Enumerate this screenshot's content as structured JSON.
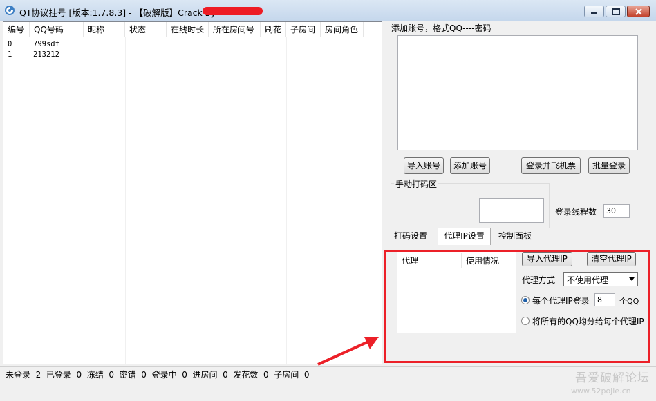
{
  "window": {
    "title": "QT协议挂号 [版本:1.7.8.3] - 【破解版】Crack by"
  },
  "table": {
    "columns": [
      "编号",
      "QQ号码",
      "昵称",
      "状态",
      "在线时长",
      "所在房间号",
      "刷花",
      "子房间",
      "房间角色"
    ],
    "rows": [
      {
        "id": "0",
        "qq": "799sdf"
      },
      {
        "id": "1",
        "qq": "213212"
      }
    ]
  },
  "accounts": {
    "label": "添加账号，格式QQ----密码",
    "import_btn": "导入账号",
    "add_btn": "添加账号",
    "login_ticket_btn": "登录并飞机票",
    "batch_login_btn": "批量登录"
  },
  "captcha": {
    "group_label": "手动打码区",
    "threads_label": "登录线程数",
    "threads_value": "30"
  },
  "tabs": [
    "打码设置",
    "代理IP设置",
    "控制面板"
  ],
  "proxy": {
    "col_proxy": "代理",
    "col_usage": "使用情况",
    "import_btn": "导入代理IP",
    "clear_btn": "清空代理IP",
    "mode_label": "代理方式",
    "mode_value": "不使用代理",
    "opt1_label": "每个代理IP登录",
    "opt1_value": "8",
    "opt1_unit": "个QQ",
    "opt2_label": "将所有的QQ均分给每个代理IP"
  },
  "status": {
    "text": "未登录  2  已登录  0  冻结  0  密错  0  登录中  0  进房间  0  发花数  0  子房间  0"
  },
  "watermark": {
    "text": "吾爱破解论坛",
    "url": "www.52pojie.cn"
  },
  "colors": {
    "highlight": "#ec2028",
    "arrow": "#ec2028"
  }
}
